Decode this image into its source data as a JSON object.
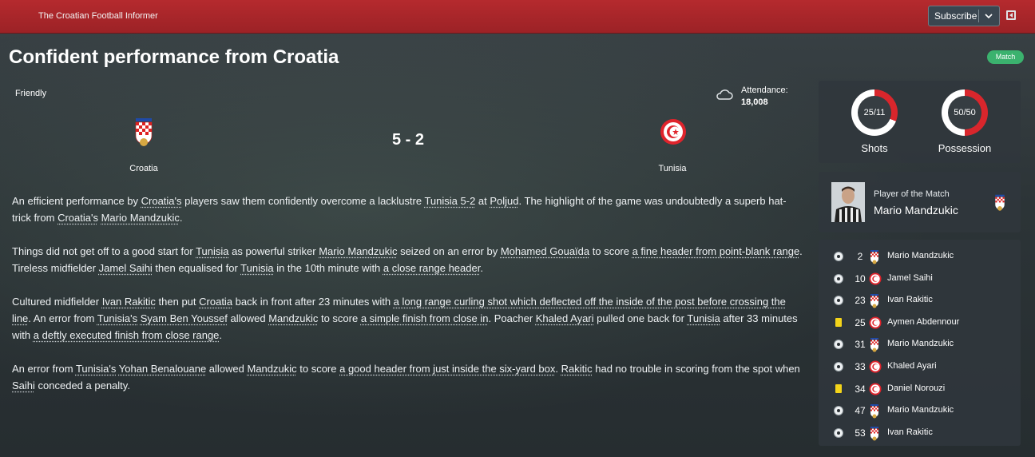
{
  "topbar": {
    "brand": "The Croatian Football Informer",
    "subscribe_label": "Subscribe"
  },
  "article": {
    "title": "Confident performance from Croatia",
    "badge": "Match"
  },
  "match": {
    "competition": "Friendly",
    "attendance_label": "Attendance:",
    "attendance_value": "18,008",
    "score": "5 - 2",
    "home": "Croatia",
    "away": "Tunisia"
  },
  "report": {
    "p1": [
      {
        "t": "An efficient performance by "
      },
      {
        "t": "Croatia's",
        "u": true
      },
      {
        "t": " players saw them confidently overcome a lacklustre "
      },
      {
        "t": "Tunisia 5-2",
        "u": true
      },
      {
        "t": " at "
      },
      {
        "t": "Poljud",
        "u": true
      },
      {
        "t": ". The highlight of the game was undoubtedly a superb hat-trick from "
      },
      {
        "t": "Croatia's",
        "u": true
      },
      {
        "t": " "
      },
      {
        "t": "Mario Mandzukic",
        "u": true
      },
      {
        "t": "."
      }
    ],
    "p2": [
      {
        "t": "Things did not get off to a good start for "
      },
      {
        "t": "Tunisia",
        "u": true
      },
      {
        "t": " as powerful striker "
      },
      {
        "t": "Mario Mandzukic",
        "u": true
      },
      {
        "t": " seized on an error by "
      },
      {
        "t": "Mohamed Gouaïda",
        "u": true
      },
      {
        "t": " to score "
      },
      {
        "t": "a fine header from point-blank range",
        "u": true
      },
      {
        "t": ". Tireless midfielder "
      },
      {
        "t": "Jamel Saihi",
        "u": true
      },
      {
        "t": " then equalised for "
      },
      {
        "t": "Tunisia",
        "u": true
      },
      {
        "t": " in the 10th minute with "
      },
      {
        "t": "a close range header",
        "u": true
      },
      {
        "t": "."
      }
    ],
    "p3": [
      {
        "t": "Cultured midfielder "
      },
      {
        "t": "Ivan Rakitic",
        "u": true
      },
      {
        "t": " then put "
      },
      {
        "t": "Croatia",
        "u": true
      },
      {
        "t": " back in front after 23 minutes with "
      },
      {
        "t": "a long range curling shot which deflected off the inside of the post before crossing the line",
        "u": true
      },
      {
        "t": ". An error from "
      },
      {
        "t": "Tunisia's",
        "u": true
      },
      {
        "t": " "
      },
      {
        "t": "Syam Ben Youssef",
        "u": true
      },
      {
        "t": " allowed "
      },
      {
        "t": "Mandzukic",
        "u": true
      },
      {
        "t": " to score "
      },
      {
        "t": "a simple finish from close in",
        "u": true
      },
      {
        "t": ". Poacher "
      },
      {
        "t": "Khaled Ayari",
        "u": true
      },
      {
        "t": " pulled one back for "
      },
      {
        "t": "Tunisia",
        "u": true
      },
      {
        "t": " after 33 minutes with "
      },
      {
        "t": "a deftly executed finish from close range",
        "u": true
      },
      {
        "t": "."
      }
    ],
    "p4": [
      {
        "t": "An error from "
      },
      {
        "t": "Tunisia's",
        "u": true
      },
      {
        "t": " "
      },
      {
        "t": "Yohan Benalouane",
        "u": true
      },
      {
        "t": " allowed "
      },
      {
        "t": "Mandzukic",
        "u": true
      },
      {
        "t": " to score "
      },
      {
        "t": "a good header from just inside the six-yard box",
        "u": true
      },
      {
        "t": ". "
      },
      {
        "t": "Rakitic",
        "u": true
      },
      {
        "t": " had no trouble in scoring from the spot when "
      },
      {
        "t": "Saihi",
        "u": true
      },
      {
        "t": " conceded a penalty."
      }
    ]
  },
  "stats": {
    "shots_value": "25/11",
    "shots_label": "Shots",
    "shots_home_share": 0.69,
    "possession_value": "50/50",
    "possession_label": "Possession",
    "possession_home_share": 0.5,
    "home_color": "#ffffff",
    "away_color": "#d9262c"
  },
  "potm": {
    "label": "Player of the Match",
    "name": "Mario Mandzukic"
  },
  "events": [
    {
      "minute": "2",
      "player": "Mario Mandzukic",
      "type": "goal",
      "team": "home"
    },
    {
      "minute": "10",
      "player": "Jamel Saihi",
      "type": "goal",
      "team": "away"
    },
    {
      "minute": "23",
      "player": "Ivan Rakitic",
      "type": "goal",
      "team": "home"
    },
    {
      "minute": "25",
      "player": "Aymen Abdennour",
      "type": "yellow-card",
      "team": "away"
    },
    {
      "minute": "31",
      "player": "Mario Mandzukic",
      "type": "goal",
      "team": "home"
    },
    {
      "minute": "33",
      "player": "Khaled Ayari",
      "type": "goal",
      "team": "away"
    },
    {
      "minute": "34",
      "player": "Daniel Norouzi",
      "type": "yellow-card",
      "team": "away"
    },
    {
      "minute": "47",
      "player": "Mario Mandzukic",
      "type": "goal",
      "team": "home"
    },
    {
      "minute": "53",
      "player": "Ivan Rakitic",
      "type": "goal",
      "team": "home"
    }
  ]
}
